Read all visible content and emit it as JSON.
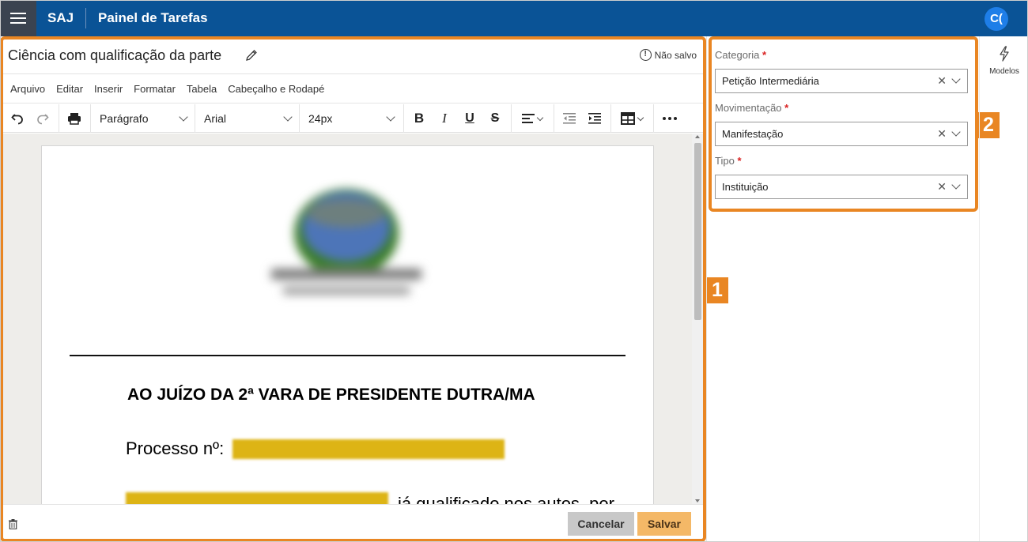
{
  "header": {
    "brand": "SAJ",
    "title": "Painel de Tarefas",
    "avatar_initials": "C("
  },
  "editor": {
    "doc_title": "Ciência com qualificação da parte",
    "save_status": "Não salvo",
    "menu": [
      "Arquivo",
      "Editar",
      "Inserir",
      "Formatar",
      "Tabela",
      "Cabeçalho e Rodapé"
    ],
    "toolbar": {
      "block_format": "Parágrafo",
      "font_family": "Arial",
      "font_size": "24px"
    },
    "document": {
      "heading": "AO JUÍZO DA 2ª VARA DE PRESIDENTE DUTRA/MA",
      "process_label": "Processo nº:",
      "body_fragment": "já qualificado nos autos, por"
    },
    "buttons": {
      "cancel": "Cancelar",
      "save": "Salvar"
    }
  },
  "form": {
    "fields": [
      {
        "label": "Categoria",
        "value": "Petição Intermediária"
      },
      {
        "label": "Movimentação",
        "value": "Manifestação"
      },
      {
        "label": "Tipo",
        "value": "Instituição"
      }
    ]
  },
  "side_rail": {
    "label": "Modelos"
  },
  "callouts": {
    "one": "1",
    "two": "2"
  },
  "colors": {
    "header_bg": "#0a5396",
    "accent_orange": "#e98623",
    "save_button": "#f4b867",
    "avatar_bg": "#1e7ee8",
    "redaction": "#ddb415"
  }
}
